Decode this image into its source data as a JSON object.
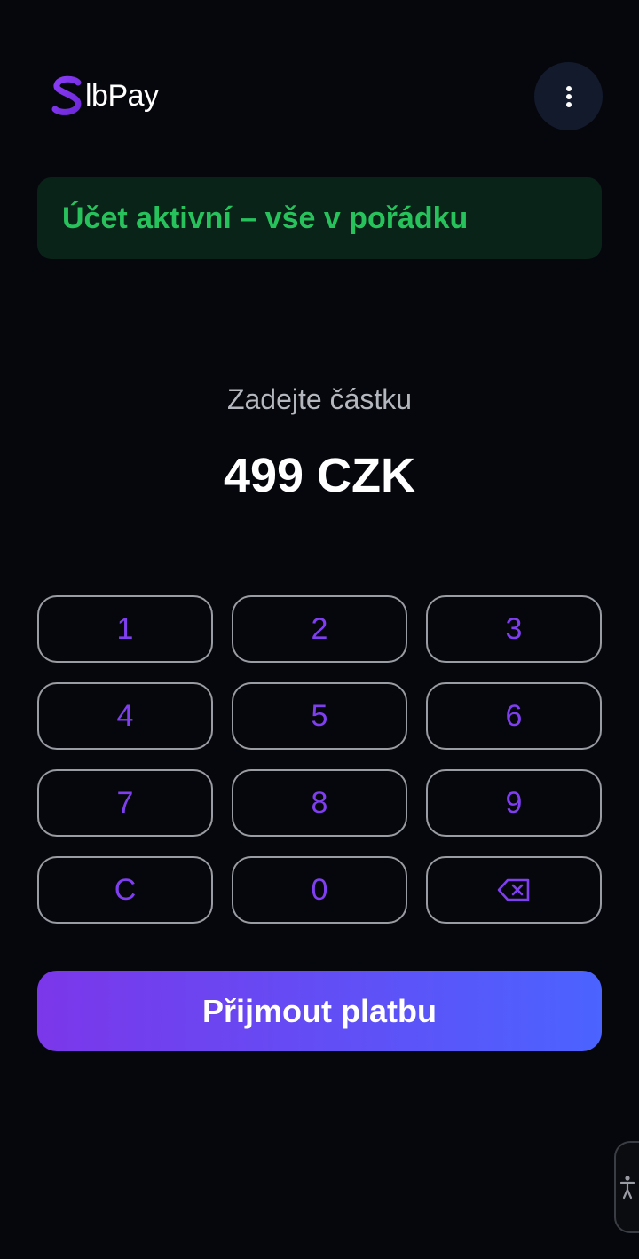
{
  "header": {
    "logo_text": "lbPay",
    "menu_icon": "more-vertical-icon"
  },
  "status": {
    "text": "Účet aktivní – vše v pořádku",
    "color": "#27c25c"
  },
  "amount": {
    "label": "Zadejte částku",
    "value": "499 CZK"
  },
  "keypad": {
    "keys": [
      "1",
      "2",
      "3",
      "4",
      "5",
      "6",
      "7",
      "8",
      "9",
      "C",
      "0"
    ],
    "backspace_icon": "backspace-icon",
    "key_color": "#7f3ff0"
  },
  "actions": {
    "accept_label": "Přijmout platbu"
  },
  "accessibility": {
    "icon": "accessibility-icon"
  },
  "colors": {
    "background": "#06070c",
    "accent_start": "#7b37ea",
    "accent_end": "#4b63ff"
  }
}
